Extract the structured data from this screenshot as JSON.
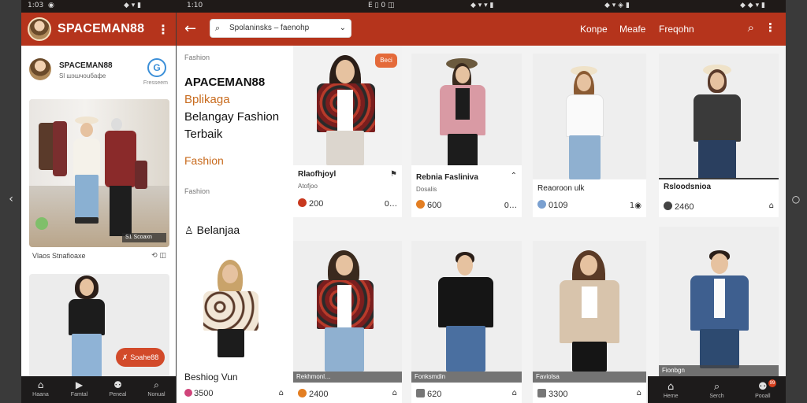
{
  "status_bar": {
    "left_time": "1:03",
    "left_icons": "◉",
    "left_right_icons": "◆ ▾ ▮",
    "mid_time": "1:10",
    "mid_icons": "E ▯ 0 ◫",
    "mid_right_icons": "◆ ▾ ▾ ▮",
    "mid2_right_icons": "◆ ▾ ◈ ▮",
    "right_right_icons": "◆ ◆ ▾ ▮"
  },
  "left_panel": {
    "app_title": "SPACEMAN88",
    "menu_icon": "more-vertical-icon",
    "profile": {
      "name": "SPACEMAN88",
      "subtitle": "Sl шэшчоuбaфe",
      "badge_letter": "G",
      "badge_label": "Fresseem"
    },
    "feed_caption": "Vlaos Stnafioaxe",
    "feed_icons": "⟲ ◫",
    "promo_label": "Soahe88",
    "bottom_nav": [
      {
        "icon": "home-icon",
        "glyph": "⌂",
        "label": "Haana"
      },
      {
        "icon": "play-icon",
        "glyph": "▶",
        "label": "Famtal"
      },
      {
        "icon": "profile-icon",
        "glyph": "⚉",
        "label": "Peneal"
      },
      {
        "icon": "search-icon",
        "glyph": "⌕",
        "label": "Nonual"
      }
    ]
  },
  "app": {
    "search": {
      "value": "Spolaninsks – faenohp"
    },
    "header_nav": [
      "Konpe",
      "Meafe",
      "Freqohn"
    ],
    "sidebar": {
      "top_label": "Fashion",
      "brand": "APACEMAN88",
      "app_line": "Bplikaga",
      "line1": "Belangay Fashion",
      "line2": "Terbaik",
      "fashion_orange": "Fashion",
      "fashion_small": "Fashion",
      "belanja": "Belanjaa",
      "bottom_title": "Beshiog Vun",
      "bottom_price": "3500",
      "cart_icon": "⌂"
    },
    "products_row1": [
      {
        "title": "Rlaofhjoyl",
        "sub": "Atofjoo",
        "price": "200",
        "right": "0…",
        "dot": "#c8381e",
        "mark": "⚑",
        "sale": "Beci"
      },
      {
        "title": "Rebnia Fasliniva",
        "sub": "Dosalis",
        "price": "600",
        "right": "0…",
        "dot": "#e37e22",
        "mark": "⌃",
        "sale": ""
      },
      {
        "title": "Reaoroon ulk",
        "sub": "",
        "price": "0109",
        "right": "1◉",
        "dot": "#7aa0d0",
        "mark": "",
        "sale": ""
      },
      {
        "title": "Rsloodsnioa",
        "sub": "",
        "price": "2460",
        "right": "⌂",
        "dot": "#444444",
        "mark": "",
        "sale": ""
      }
    ],
    "products_row2": [
      {
        "caption": "Rekhmonl…",
        "price": "2400",
        "right": "⌂",
        "dot": "#e37e22"
      },
      {
        "caption": "Fonksmdin",
        "price": "620",
        "right": "⌂",
        "dot": "#777777"
      },
      {
        "caption": "Faviolsa",
        "price": "3300",
        "right": "⌂",
        "dot": "#777777"
      },
      {
        "caption": "Fionbgn",
        "price": "",
        "right": "",
        "dot": ""
      }
    ],
    "bottom_nav": [
      {
        "icon": "home-icon",
        "glyph": "⌂",
        "label": "Heme"
      },
      {
        "icon": "search-icon",
        "glyph": "⌕",
        "label": "Serch"
      },
      {
        "icon": "profile-icon",
        "glyph": "⚉",
        "label": "Pooall",
        "badge": "99"
      }
    ]
  },
  "colors": {
    "header_red": "#b5341c",
    "accent_orange": "#c86b1e",
    "nav_dark": "#1d1b1b"
  }
}
